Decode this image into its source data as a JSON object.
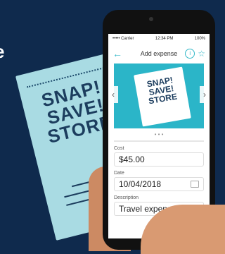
{
  "background": {
    "hero_word": "e",
    "receipt_text": "SNAP!\nSAVE!\nSTORE"
  },
  "phone": {
    "status": {
      "carrier": "••••• Carrier",
      "time": "12:34 PM",
      "battery": "100%"
    },
    "nav": {
      "back_icon": "←",
      "title": "Add expense",
      "info_icon": "i",
      "star_icon": "☆"
    },
    "carousel": {
      "image_text": "SNAP!\nSAVE!\nSTORE",
      "left_arrow": "‹",
      "right_arrow": "›",
      "page_dots": "• • •"
    },
    "form": {
      "cost_label": "Cost",
      "cost_value": "$45.00",
      "date_label": "Date",
      "date_value": "10/04/2018",
      "description_label": "Description",
      "description_value": "Travel expenses"
    }
  }
}
